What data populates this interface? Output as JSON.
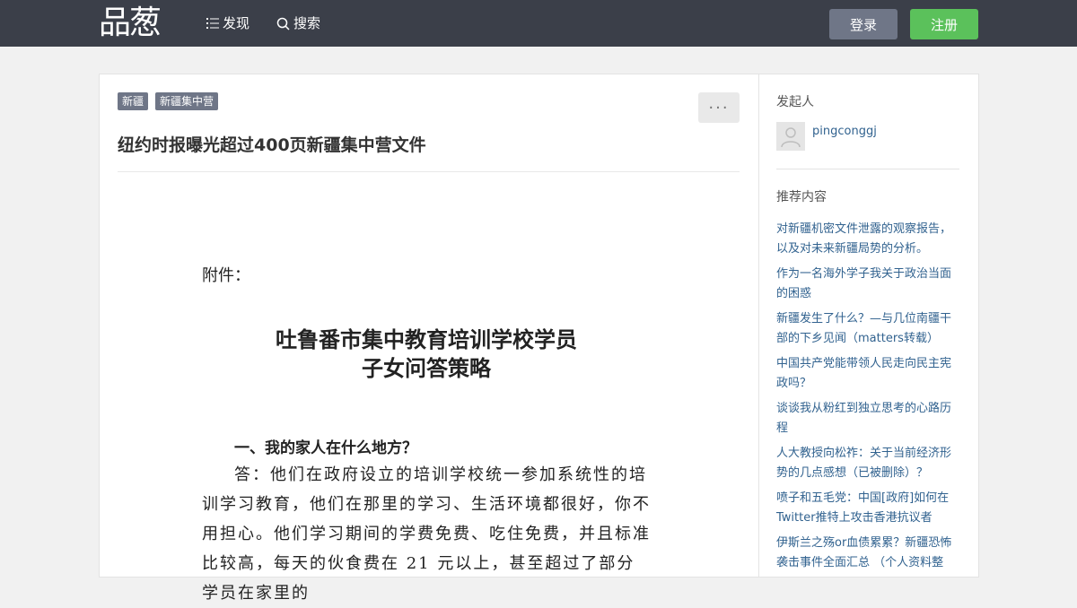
{
  "header": {
    "logo": "品葱",
    "nav": {
      "discover": "发现",
      "search": "搜索"
    },
    "login": "登录",
    "register": "注册"
  },
  "post": {
    "tags": [
      "新疆",
      "新疆集中营"
    ],
    "more": "···",
    "title": "纽约时报曝光超过400页新疆集中营文件"
  },
  "document": {
    "attachment": "附件：",
    "title_line1": "吐鲁番市集中教育培训学校学员",
    "title_line2": "子女问答策略",
    "question": "一、我的家人在什么地方？",
    "answer": "答：他们在政府设立的培训学校统一参加系统性的培训学习教育，他们在那里的学习、生活环境都很好，你不用担心。他们学习期间的学费免费、吃住免费，并且标准比较高，每天的伙食费在 21 元以上，甚至超过了部分学员在家里的"
  },
  "sidebar": {
    "initiator_heading": "发起人",
    "username": "pingconggj",
    "recommend_heading": "推荐内容",
    "recommended": [
      "对新疆机密文件泄露的观察报告，以及对未来新疆局势的分析。",
      "作为一名海外学子我关于政治当面的困惑",
      "新疆发生了什么？—与几位南疆干部的下乡见闻（matters转载）",
      "中国共产党能带领人民走向民主宪政吗？",
      "谈谈我从粉红到独立思考的心路历程",
      "人大教授向松祚：关于当前经济形势的几点感想（已被删除）？",
      "喷子和五毛党：中国[政府]如何在Twitter推特上攻击香港抗议者",
      "伊斯兰之殇or血债累累？新疆恐怖袭击事件全面汇总 （个人资料整"
    ]
  },
  "colors": {
    "topbar": "#3b3f49",
    "login_btn": "#6f7687",
    "register_btn": "#5bc15b",
    "link": "#31628f"
  }
}
